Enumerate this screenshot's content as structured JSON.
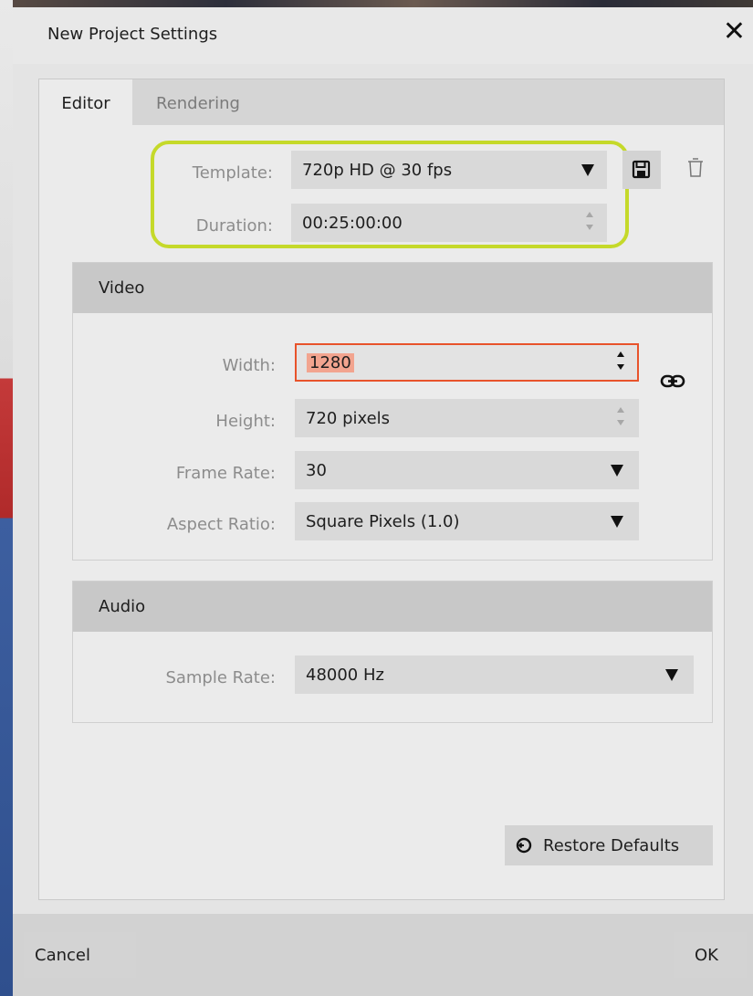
{
  "dialog": {
    "title": "New Project Settings",
    "close_glyph": "✕"
  },
  "tabs": [
    {
      "label": "Editor",
      "active": true
    },
    {
      "label": "Rendering",
      "active": false
    }
  ],
  "template": {
    "label": "Template:",
    "value": "720p HD @ 30 fps",
    "icons": [
      "save-icon",
      "trash-icon"
    ]
  },
  "duration": {
    "label": "Duration:",
    "value": "00:25:00:00"
  },
  "video": {
    "title": "Video",
    "width": {
      "label": "Width:",
      "value": "1280"
    },
    "height": {
      "label": "Height:",
      "value": "720 pixels"
    },
    "frame_rate": {
      "label": "Frame Rate:",
      "value": "30"
    },
    "aspect_ratio": {
      "label": "Aspect Ratio:",
      "value": "Square Pixels (1.0)"
    },
    "link_icon": "link-icon"
  },
  "audio": {
    "title": "Audio",
    "sample_rate": {
      "label": "Sample Rate:",
      "value": "48000 Hz"
    }
  },
  "buttons": {
    "restore_defaults": "Restore Defaults",
    "cancel": "Cancel",
    "ok": "OK"
  },
  "colors": {
    "highlight_outline": "#c5d92a",
    "focused_field_border": "#e8532b",
    "selection": "#f2a48f"
  }
}
